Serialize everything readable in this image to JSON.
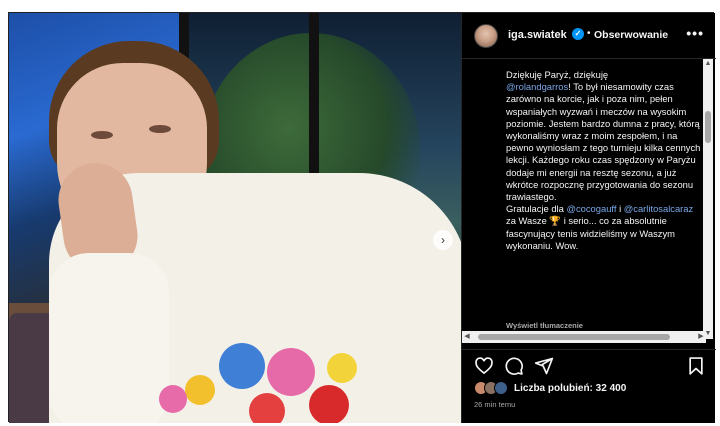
{
  "post": {
    "username": "iga.swiatek",
    "verified_mark": "✓",
    "separator": "•",
    "follow_label": "Obserwowanie",
    "more_label": "•••",
    "caption": {
      "line1": "Dziękuję Paryż, dziękuję",
      "mention1": "@rolandgarros",
      "text1": "! To był niesamowity czas zarówno na korcie, jak i poza nim, pełen wspaniałych wyzwań i meczów na wysokim poziomie. Jestem bardzo dumna z pracy, którą wykonaliśmy wraz z moim zespołem, i na pewno wyniosłam z tego turnieju kilka cennych lekcji. Każdego roku czas spędzony w Paryżu dodaje mi energii na resztę sezonu, a już wkrótce rozpocznę przygotowania do sezonu trawiastego.",
      "text2_prefix": "Gratulacje dla ",
      "mention2": "@cocogauff",
      "text2_mid": " i ",
      "mention3": "@carlitosalcaraz",
      "text2_suffix": " za Wasze 🏆 i serio... co za absolutnie fascynujący tenis widzieliśmy w Waszym wykonaniu. Wow."
    },
    "translate_label": "Wyświetl tłumaczenie",
    "likes_label": "Liczba polubień: 32 400",
    "time_label": "26 min temu",
    "next_icon": "›"
  },
  "icons": {
    "like": "heart-icon",
    "comment": "comment-icon",
    "share": "share-icon",
    "save": "bookmark-icon"
  }
}
